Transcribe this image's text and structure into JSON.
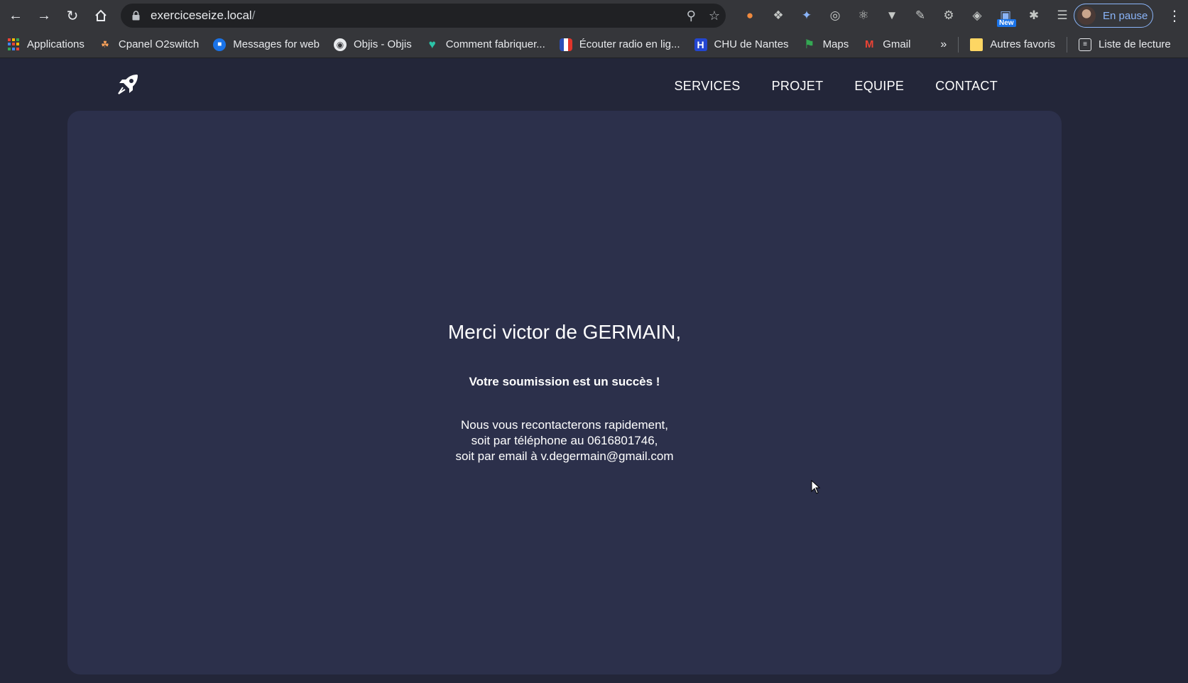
{
  "browser": {
    "url_host": "exerciceseize.local",
    "url_path": "/",
    "profile_label": "En pause",
    "extension_badge": "New"
  },
  "bookmarks": [
    {
      "label": "Applications",
      "icon": "apps-grid-icon"
    },
    {
      "label": "Cpanel O2switch",
      "icon": "cpanel-icon"
    },
    {
      "label": "Messages for web",
      "icon": "messages-icon"
    },
    {
      "label": "Objis - Objis",
      "icon": "globe-icon"
    },
    {
      "label": "Comment fabriquer...",
      "icon": "heart-icon"
    },
    {
      "label": "Écouter radio en lig...",
      "icon": "radio-flag-icon"
    },
    {
      "label": "CHU de Nantes",
      "icon": "hospital-icon"
    },
    {
      "label": "Maps",
      "icon": "maps-pin-icon"
    },
    {
      "label": "Gmail",
      "icon": "gmail-icon"
    }
  ],
  "bookmarks_overflow": "»",
  "other_bookmarks": "Autres favoris",
  "reading_list": "Liste de lecture",
  "site": {
    "nav": [
      "SERVICES",
      "PROJET",
      "EQUIPE",
      "CONTACT"
    ]
  },
  "confirmation": {
    "greeting": "Merci victor de GERMAIN,",
    "success": "Votre soumission est un succès !",
    "line1": "Nous vous recontacterons rapidement,",
    "line2": "soit par téléphone au 0616801746,",
    "line3": "soit par email à v.degermain@gmail.com"
  },
  "colors": {
    "page_bg": "#232639",
    "card_bg": "#2c304b",
    "chrome_bg": "#35363a"
  }
}
